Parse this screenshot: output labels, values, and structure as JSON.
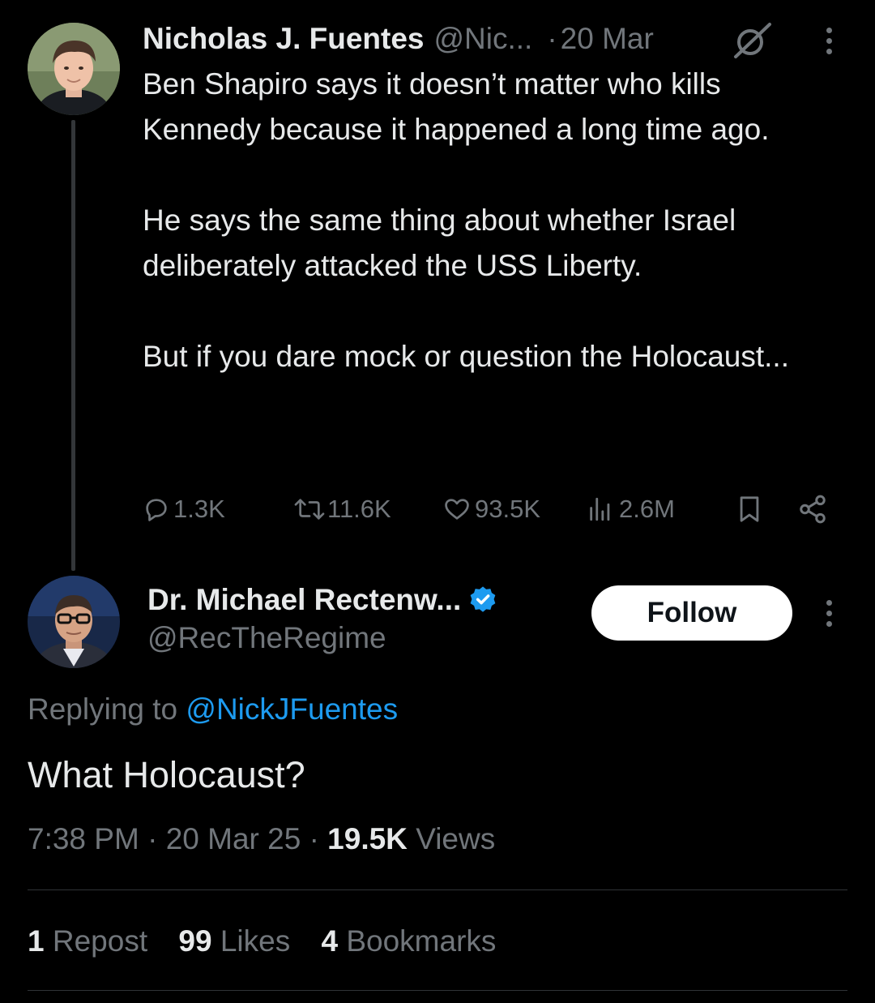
{
  "original_tweet": {
    "author_name": "Nicholas J. Fuentes",
    "handle": "@Nic...",
    "separator": "·",
    "date": "20 Mar",
    "paragraphs": [
      "Ben Shapiro says it doesn’t matter who kills Kennedy because it happened a long time ago.",
      "He says the same thing about whether Israel deliberately attacked the USS Liberty.",
      "But if you dare mock or question the Holocaust..."
    ],
    "stats": {
      "replies": "1.3K",
      "reposts": "11.6K",
      "likes": "93.5K",
      "views": "2.6M"
    },
    "icons": [
      "grok-icon",
      "more-icon",
      "reply-icon",
      "repost-icon",
      "like-icon",
      "views-icon",
      "bookmark-icon",
      "share-icon"
    ]
  },
  "reply_tweet": {
    "author_name": "Dr. Michael Rectenw...",
    "verified": true,
    "handle": "@RecTheRegime",
    "follow_label": "Follow",
    "replying_prefix": "Replying to",
    "replying_to": "@NickJFuentes",
    "text": "What Holocaust?",
    "time": "7:38 PM",
    "date": "20 Mar 25",
    "views_count": "19.5K",
    "views_label": "Views",
    "engagement": {
      "reposts_count": "1",
      "reposts_label": "Repost",
      "likes_count": "99",
      "likes_label": "Likes",
      "bookmarks_count": "4",
      "bookmarks_label": "Bookmarks"
    }
  },
  "colors": {
    "background": "#000000",
    "text": "#e7e9ea",
    "muted": "#71767b",
    "link": "#1d9bf0",
    "verified": "#1d9bf0",
    "divider": "#2f3336"
  }
}
